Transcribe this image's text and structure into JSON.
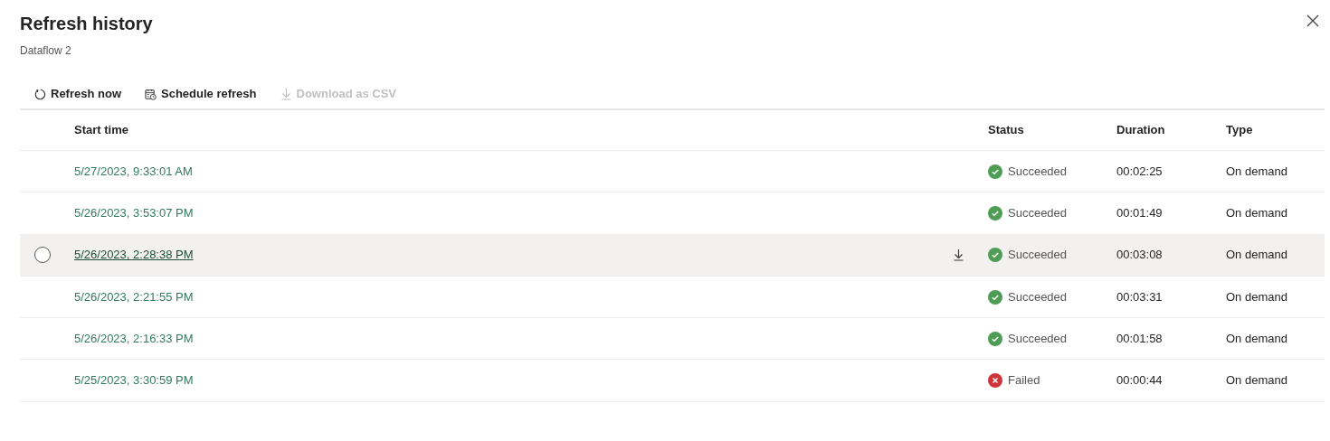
{
  "panel": {
    "title": "Refresh history",
    "subtitle": "Dataflow 2"
  },
  "toolbar": [
    {
      "label": "Refresh now",
      "kind": "refresh",
      "disabled": false
    },
    {
      "label": "Schedule refresh",
      "kind": "schedule",
      "disabled": false
    },
    {
      "label": "Download as CSV",
      "kind": "download",
      "disabled": true
    }
  ],
  "table": {
    "columns": [
      "Start time",
      "Status",
      "Duration",
      "Type"
    ],
    "rows": [
      {
        "start_time": "5/27/2023, 9:33:01 AM",
        "status": "Succeeded",
        "kind": "succeeded",
        "duration": "00:02:25",
        "type": "On demand",
        "hovered": false
      },
      {
        "start_time": "5/26/2023, 3:53:07 PM",
        "status": "Succeeded",
        "kind": "succeeded",
        "duration": "00:01:49",
        "type": "On demand",
        "hovered": false
      },
      {
        "start_time": "5/26/2023, 2:28:38 PM",
        "status": "Succeeded",
        "kind": "succeeded",
        "duration": "00:03:08",
        "type": "On demand",
        "hovered": true
      },
      {
        "start_time": "5/26/2023, 2:21:55 PM",
        "status": "Succeeded",
        "kind": "succeeded",
        "duration": "00:03:31",
        "type": "On demand",
        "hovered": false
      },
      {
        "start_time": "5/26/2023, 2:16:33 PM",
        "status": "Succeeded",
        "kind": "succeeded",
        "duration": "00:01:58",
        "type": "On demand",
        "hovered": false
      },
      {
        "start_time": "5/25/2023, 3:30:59 PM",
        "status": "Failed",
        "kind": "failed",
        "duration": "00:00:44",
        "type": "On demand",
        "hovered": false
      }
    ]
  }
}
